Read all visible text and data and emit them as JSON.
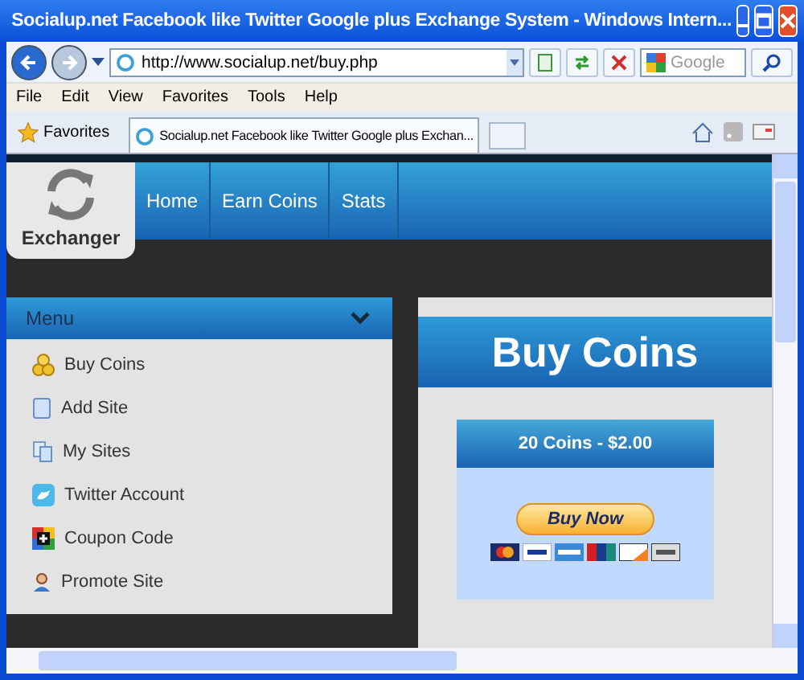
{
  "window": {
    "title": "Socialup.net Facebook like Twitter Google plus Exchange System - Windows Intern..."
  },
  "address_bar": {
    "url": "http://www.socialup.net/buy.php"
  },
  "search": {
    "placeholder": "Google"
  },
  "menu_bar": [
    "File",
    "Edit",
    "View",
    "Favorites",
    "Tools",
    "Help"
  ],
  "favorites_bar": {
    "label": "Favorites",
    "tab": "Socialup.net Facebook like Twitter Google plus Exchan..."
  },
  "site": {
    "logo": "Exchanger",
    "nav": [
      "Home",
      "Earn Coins",
      "Stats"
    ],
    "sidebar": {
      "title": "Menu",
      "items": [
        {
          "label": "Buy Coins",
          "kind": "coins"
        },
        {
          "label": "Add Site",
          "kind": "page"
        },
        {
          "label": "My Sites",
          "kind": "pages"
        },
        {
          "label": "Twitter Account",
          "kind": "bird"
        },
        {
          "label": "Coupon Code",
          "kind": "plus"
        },
        {
          "label": "Promote Site",
          "kind": "person"
        }
      ]
    },
    "heading": "Buy Coins",
    "offer": {
      "title": "20 Coins - $2.00",
      "button": "Buy Now"
    }
  }
}
